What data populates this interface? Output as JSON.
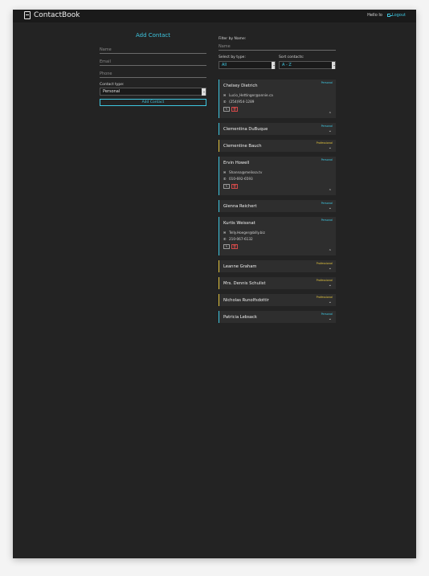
{
  "app": {
    "brand": "ContactBook",
    "greeting": "Hello Io",
    "logout_label": "Logout"
  },
  "add_form": {
    "title": "Add Contact",
    "name_placeholder": "Name",
    "email_placeholder": "Email",
    "phone_placeholder": "Phone",
    "type_label": "Contact type:",
    "type_value": "Personal",
    "submit_label": "Add Contact"
  },
  "filters": {
    "filter_label": "Filter by Name:",
    "filter_placeholder": "Name",
    "type_label": "Select by type:",
    "type_value": "All",
    "sort_label": "Sort contacts:",
    "sort_value": "A - Z"
  },
  "colors": {
    "accent_personal": "#3ec6e0",
    "accent_professional": "#e0c23e",
    "delete": "#e05050"
  },
  "contacts": [
    {
      "name": "Chelsey Dietrich",
      "type": "Personal",
      "expanded": true,
      "email": "Lucio_Hettinger@annie.ca",
      "phone": "(254)954-1289",
      "chevron": "⌃"
    },
    {
      "name": "Clementina DuBuque",
      "type": "Personal",
      "expanded": false,
      "chevron": "⌄"
    },
    {
      "name": "Clementine Bauch",
      "type": "Professional",
      "expanded": false,
      "chevron": "⌄"
    },
    {
      "name": "Ervin Howell",
      "type": "Personal",
      "expanded": true,
      "email": "Shanna@melissa.tv",
      "phone": "010-692-6593",
      "chevron": "⌃"
    },
    {
      "name": "Glenna Reichert",
      "type": "Personal",
      "expanded": false,
      "chevron": "⌄"
    },
    {
      "name": "Kurtis Weissnat",
      "type": "Personal",
      "expanded": true,
      "email": "Telly.Hoeger@billy.biz",
      "phone": "210-067-6132",
      "chevron": "⌃"
    },
    {
      "name": "Leanne Graham",
      "type": "Professional",
      "expanded": false,
      "chevron": "⌄"
    },
    {
      "name": "Mrs. Dennis Schulist",
      "type": "Professional",
      "expanded": false,
      "chevron": "⌄"
    },
    {
      "name": "Nicholas Runolfsdottir",
      "type": "Professional",
      "expanded": false,
      "chevron": "⌄"
    },
    {
      "name": "Patricia Lebsack",
      "type": "Personal",
      "expanded": false,
      "chevron": "⌄"
    }
  ],
  "icons": {
    "email_icon": "✉",
    "phone_icon": "✆",
    "edit_icon": "✎",
    "delete_icon": "🗑"
  }
}
